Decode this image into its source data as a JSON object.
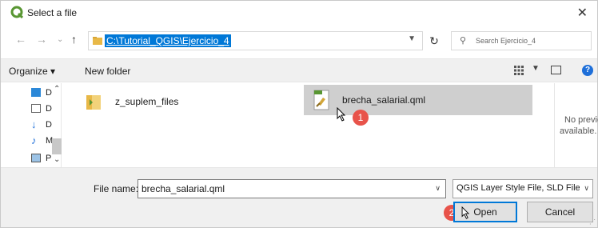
{
  "window": {
    "title": "Select a file"
  },
  "address": {
    "path": "C:\\Tutorial_QGIS\\Ejercicio_4"
  },
  "search": {
    "placeholder": "Search Ejercicio_4"
  },
  "toolbar": {
    "organize": "Organize ▾",
    "new_folder": "New folder"
  },
  "nav_items": [
    {
      "label": "D",
      "icon": "desktop-icon"
    },
    {
      "label": "D",
      "icon": "documents-icon"
    },
    {
      "label": "D",
      "icon": "downloads-icon"
    },
    {
      "label": "M",
      "icon": "music-icon"
    },
    {
      "label": "P",
      "icon": "pictures-icon"
    }
  ],
  "files": [
    {
      "name": "z_suplem_files",
      "icon": "folder-icon",
      "selected": false
    },
    {
      "name": "brecha_salarial.qml",
      "icon": "qml-file-icon",
      "selected": true
    }
  ],
  "preview": {
    "line1": "No preview",
    "line2": "available."
  },
  "bottom": {
    "file_name_label": "File name:",
    "file_name_value": "brecha_salarial.qml",
    "filter_value": "QGIS Layer Style File, SLD File (*",
    "open_label": "Open",
    "cancel_label": "Cancel"
  },
  "annotations": {
    "badge1": "1",
    "badge2": "2"
  },
  "colors": {
    "accent": "#0078d7",
    "badge": "#e8534a",
    "qgis_green": "#589632"
  }
}
